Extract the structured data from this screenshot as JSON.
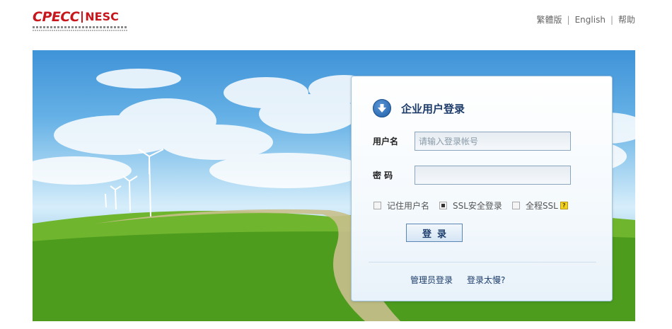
{
  "header": {
    "logo_text_1": "CPECC",
    "logo_text_2": "NESC",
    "links": [
      "繁體版",
      "English",
      "帮助"
    ]
  },
  "login": {
    "title": "企业用户登录",
    "username_label": "用户名",
    "username_placeholder": "请输入登录帐号",
    "password_label": "密 码",
    "password_value": "",
    "options": [
      {
        "label": "记住用户名",
        "checked": false
      },
      {
        "label": "SSL安全登录",
        "checked": true
      },
      {
        "label": "全程SSL",
        "checked": false
      }
    ],
    "help_glyph": "?",
    "submit_label": "登录",
    "admin_link": "管理员登录",
    "slow_link": "登录太慢?"
  },
  "colors": {
    "brand_red": "#c8161d",
    "title_blue": "#1d3c6a"
  }
}
